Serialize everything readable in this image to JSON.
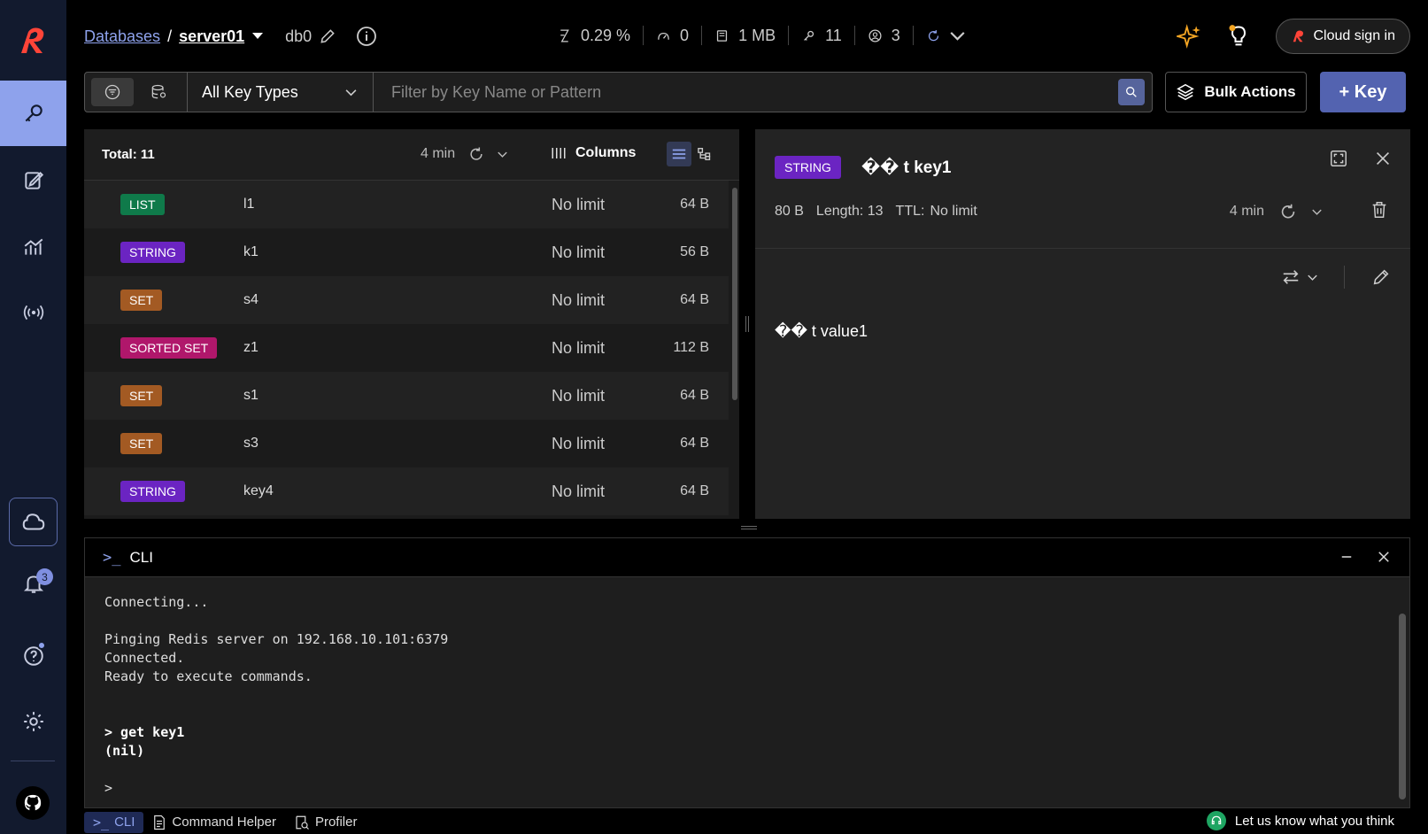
{
  "header": {
    "breadcrumb_root": "Databases",
    "separator": "/",
    "server": "server01",
    "db": "db0",
    "stats": {
      "cpu": "0.29 %",
      "ops": "0",
      "memory": "1 MB",
      "keys": "11",
      "clients": "3"
    },
    "cloud_signin_label": "Cloud sign in"
  },
  "sidebar": {
    "notification_count": "3"
  },
  "filter": {
    "key_type": "All Key Types",
    "search_placeholder": "Filter by Key Name or Pattern",
    "bulk_actions_label": "Bulk Actions",
    "add_key_label": "+ Key"
  },
  "keylist": {
    "total": "Total: 11",
    "refresh_time": "4 min",
    "columns_label": "Columns",
    "rows": [
      {
        "type": "LIST",
        "color": "#0f7a4a",
        "name": "l1",
        "ttl": "No limit",
        "size": "64 B"
      },
      {
        "type": "STRING",
        "color": "#6b24c2",
        "name": "k1",
        "ttl": "No limit",
        "size": "56 B"
      },
      {
        "type": "SET",
        "color": "#a35a23",
        "name": "s4",
        "ttl": "No limit",
        "size": "64 B"
      },
      {
        "type": "SORTED SET",
        "color": "#b0176b",
        "name": "z1",
        "ttl": "No limit",
        "size": "112 B"
      },
      {
        "type": "SET",
        "color": "#a35a23",
        "name": "s1",
        "ttl": "No limit",
        "size": "64 B"
      },
      {
        "type": "SET",
        "color": "#a35a23",
        "name": "s3",
        "ttl": "No limit",
        "size": "64 B"
      },
      {
        "type": "STRING",
        "color": "#6b24c2",
        "name": "key4",
        "ttl": "No limit",
        "size": "64 B"
      }
    ]
  },
  "details": {
    "type": "STRING",
    "key_name": "�� t key1",
    "size": "80 B",
    "length": "Length: 13",
    "ttl_label": "TTL:",
    "ttl_value": "No limit",
    "refresh_time": "4 min",
    "value": "�� t value1"
  },
  "cli": {
    "title": "CLI",
    "lines": [
      "Connecting...",
      "",
      "Pinging Redis server on 192.168.10.101:6379",
      "Connected.",
      "Ready to execute commands.",
      "",
      "",
      "> get key1",
      "(nil)",
      "",
      ">"
    ]
  },
  "bottombar": {
    "cli_label": "CLI",
    "command_helper_label": "Command Helper",
    "profiler_label": "Profiler",
    "feedback_label": "Let us know what you think"
  }
}
